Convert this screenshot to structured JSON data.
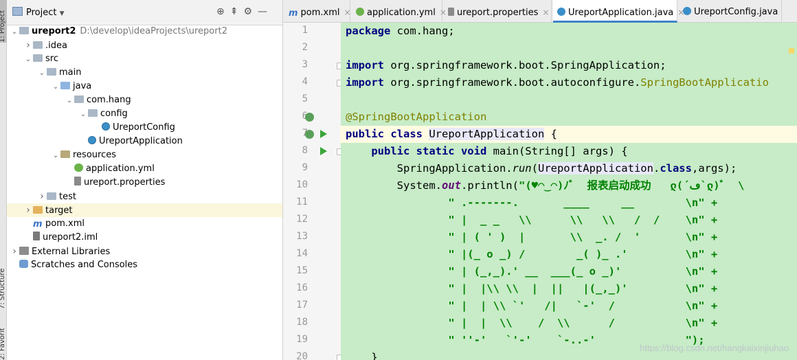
{
  "side_strip": {
    "project_label": "1: Project",
    "structure_label": "7: Structure",
    "favorites_label": "2: Favorites"
  },
  "project_panel": {
    "title": "Project",
    "tree": [
      {
        "label": "ureport2",
        "path": "D:\\develop\\ideaProjects\\ureport2",
        "depth": 0,
        "expanded": true,
        "icon": "folder-icon"
      },
      {
        "label": ".idea",
        "depth": 1,
        "expanded": false,
        "icon": "folder-icon"
      },
      {
        "label": "src",
        "depth": 1,
        "expanded": true,
        "icon": "folder-icon"
      },
      {
        "label": "main",
        "depth": 2,
        "expanded": true,
        "icon": "folder-icon"
      },
      {
        "label": "java",
        "depth": 3,
        "expanded": true,
        "icon": "source-folder-icon"
      },
      {
        "label": "com.hang",
        "depth": 4,
        "expanded": true,
        "icon": "package-icon"
      },
      {
        "label": "config",
        "depth": 5,
        "expanded": true,
        "icon": "package-icon"
      },
      {
        "label": "UreportConfig",
        "depth": 6,
        "icon": "class-icon"
      },
      {
        "label": "UreportApplication",
        "depth": 5,
        "icon": "spring-class-icon"
      },
      {
        "label": "resources",
        "depth": 3,
        "expanded": true,
        "icon": "resources-folder-icon"
      },
      {
        "label": "application.yml",
        "depth": 4,
        "icon": "yaml-icon"
      },
      {
        "label": "ureport.properties",
        "depth": 4,
        "icon": "properties-icon"
      },
      {
        "label": "test",
        "depth": 2,
        "expanded": false,
        "icon": "folder-icon"
      },
      {
        "label": "target",
        "depth": 1,
        "expanded": false,
        "icon": "excluded-folder-icon",
        "selected": true
      },
      {
        "label": "pom.xml",
        "depth": 1,
        "icon": "maven-icon"
      },
      {
        "label": "ureport2.iml",
        "depth": 1,
        "icon": "iml-icon"
      },
      {
        "label": "External Libraries",
        "depth": 0,
        "expanded": false,
        "icon": "library-icon"
      },
      {
        "label": "Scratches and Consoles",
        "depth": 0,
        "icon": "scratch-icon"
      }
    ]
  },
  "tabs": [
    {
      "label": "pom.xml",
      "icon": "m"
    },
    {
      "label": "application.yml",
      "icon": "yml"
    },
    {
      "label": "ureport.properties",
      "icon": "props"
    },
    {
      "label": "UreportApplication.java",
      "icon": "cls",
      "active": true
    },
    {
      "label": "UreportConfig.java",
      "icon": "cls"
    }
  ],
  "code": {
    "line_numbers": [
      "1",
      "2",
      "3",
      "4",
      "5",
      "6",
      "7",
      "8",
      "9",
      "10",
      "11",
      "12",
      "13",
      "14",
      "15",
      "16",
      "17",
      "18",
      "19",
      "20"
    ],
    "l1_kw": "package",
    "l1_rest": " com.hang;",
    "l3_kw": "import",
    "l3_rest": " org.springframework.boot.SpringApplication;",
    "l4_kw": "import",
    "l4_rest": " org.springframework.boot.autoconfigure.",
    "l4_ann": "SpringBootApplicatio",
    "l6_ann": "@SpringBootApplication",
    "l7_kw": "public class",
    "l7_name": "UreportApplication",
    "l7_rest": " {",
    "l8_kw": "public static void",
    "l8_rest": " main(String[] args) {",
    "l9_a": "SpringApplication.",
    "l9_run": "run",
    "l9_b": "(",
    "l9_cls": "UreportApplication",
    "l9_c": ".",
    "l9_kw": "class",
    "l9_d": ",args);",
    "l10_a": "System.",
    "l10_out": "out",
    "l10_b": ".println(",
    "l10_str": "\"(♥◠‿◠)ﾉﾞ  报表启动成功   ლ(´ڡ`ლ)ﾞ  \\",
    "ascii": [
      "\" .-------.       ____     __        \\n\" +",
      "\" |  _ _   \\\\      \\\\   \\\\   /  /    \\n\" +",
      "\" | ( ' )  |       \\\\  _. /  '       \\n\" +",
      "\" |(_ o _) /        _( )_ .'         \\n\" +",
      "\" | (_,_).' __  ___(_ o _)'          \\n\" +",
      "\" |  |\\\\ \\\\  |  ||   |(_,_)'         \\n\" +",
      "\" |  | \\\\ `'   /|   `-'  /           \\n\" +",
      "\" |  |  \\\\    /  \\\\      /           \\n\" +",
      "\" ''-'   `'-'    `-..-'              \");"
    ],
    "l20": "    }"
  },
  "watermark": "https://blog.csdn.net/hangkaixinjiuhao"
}
